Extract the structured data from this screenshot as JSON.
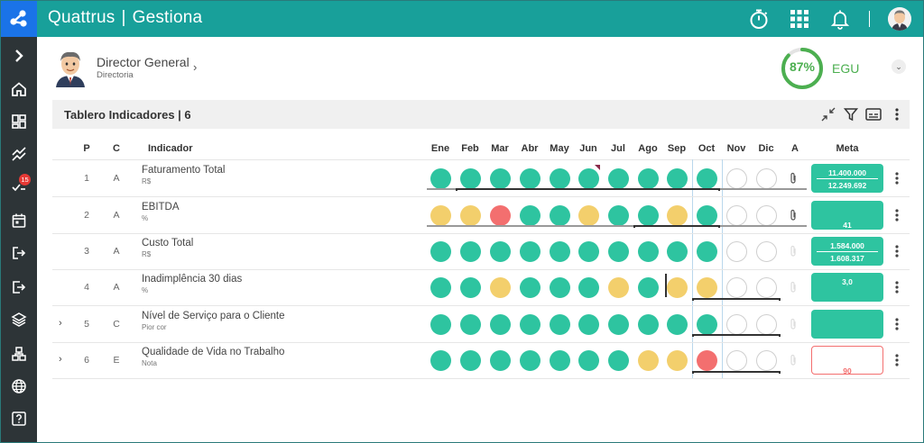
{
  "app": {
    "brand_left": "Quattrus",
    "brand_sep": "|",
    "brand_right": "Gestiona"
  },
  "topbar_icons": [
    "stopwatch-icon",
    "apps-grid-icon",
    "bell-icon"
  ],
  "sidebar": {
    "items": [
      {
        "name": "expand-chevron-icon"
      },
      {
        "name": "home-icon"
      },
      {
        "name": "dashboard-icon"
      },
      {
        "name": "trend-chart-icon"
      },
      {
        "name": "checklist-icon",
        "badge": "15"
      },
      {
        "name": "calendar-icon"
      },
      {
        "name": "export-icon"
      },
      {
        "name": "logout-icon"
      },
      {
        "name": "layers-icon"
      },
      {
        "name": "org-chart-icon"
      },
      {
        "name": "globe-icon"
      },
      {
        "name": "help-icon"
      }
    ]
  },
  "header": {
    "title": "Director General",
    "subtitle": "Directoria",
    "score": "87%",
    "score_value": 0.87,
    "score_label": "EGU"
  },
  "panel": {
    "title": "Tablero Indicadores | 6"
  },
  "columns": {
    "p": "P",
    "c": "C",
    "indicator": "Indicador",
    "months": [
      "Ene",
      "Feb",
      "Mar",
      "Abr",
      "May",
      "Jun",
      "Jul",
      "Ago",
      "Sep",
      "Oct",
      "Nov",
      "Dic"
    ],
    "a": "A",
    "meta": "Meta"
  },
  "rows": [
    {
      "p": "1",
      "c": "A",
      "name": "Faturamento Total",
      "unit": "R$",
      "expandable": false,
      "status": [
        "g",
        "g",
        "g",
        "g",
        "g",
        "g",
        "g",
        "g",
        "g",
        "g",
        "e",
        "e"
      ],
      "attach": true,
      "meta_line1": "11.400.000",
      "meta_line2": "12.249.692",
      "meta_style": "green"
    },
    {
      "p": "2",
      "c": "A",
      "name": "EBITDA",
      "unit": "%",
      "expandable": false,
      "status": [
        "y",
        "y",
        "r",
        "g",
        "g",
        "y",
        "g",
        "g",
        "y",
        "g",
        "e",
        "e"
      ],
      "attach": true,
      "meta_line1": "",
      "meta_line2": "41",
      "meta_style": "green"
    },
    {
      "p": "3",
      "c": "A",
      "name": "Custo Total",
      "unit": "R$",
      "expandable": false,
      "status": [
        "g",
        "g",
        "g",
        "g",
        "g",
        "g",
        "g",
        "g",
        "g",
        "g",
        "e",
        "e"
      ],
      "attach": false,
      "meta_line1": "1.584.000",
      "meta_line2": "1.608.317",
      "meta_style": "green"
    },
    {
      "p": "4",
      "c": "A",
      "name": "Inadimplência 30 dias",
      "unit": "%",
      "expandable": false,
      "status": [
        "g",
        "g",
        "y",
        "g",
        "g",
        "g",
        "y",
        "g",
        "y",
        "y",
        "e",
        "e"
      ],
      "attach": false,
      "meta_line1": "3,0",
      "meta_line2": "",
      "meta_style": "green"
    },
    {
      "p": "5",
      "c": "C",
      "name": "Nível de Serviço para o Cliente",
      "unit": "Pior cor",
      "expandable": true,
      "status": [
        "g",
        "g",
        "g",
        "g",
        "g",
        "g",
        "g",
        "g",
        "g",
        "g",
        "e",
        "e"
      ],
      "attach": false,
      "meta_line1": "",
      "meta_line2": "",
      "meta_style": "green"
    },
    {
      "p": "6",
      "c": "E",
      "name": "Qualidade de Vida no Trabalho",
      "unit": "Nota",
      "expandable": true,
      "status": [
        "g",
        "g",
        "g",
        "g",
        "g",
        "g",
        "g",
        "y",
        "y",
        "r",
        "e",
        "e"
      ],
      "attach": false,
      "meta_line1": "",
      "meta_line2": "90",
      "meta_style": "red"
    }
  ],
  "colors": {
    "topbar": "#18a09a",
    "sidebar": "#2d3437",
    "green": "#2ec4a0",
    "yellow": "#f3cf6c",
    "red": "#f36f6f",
    "score": "#4caf50"
  }
}
